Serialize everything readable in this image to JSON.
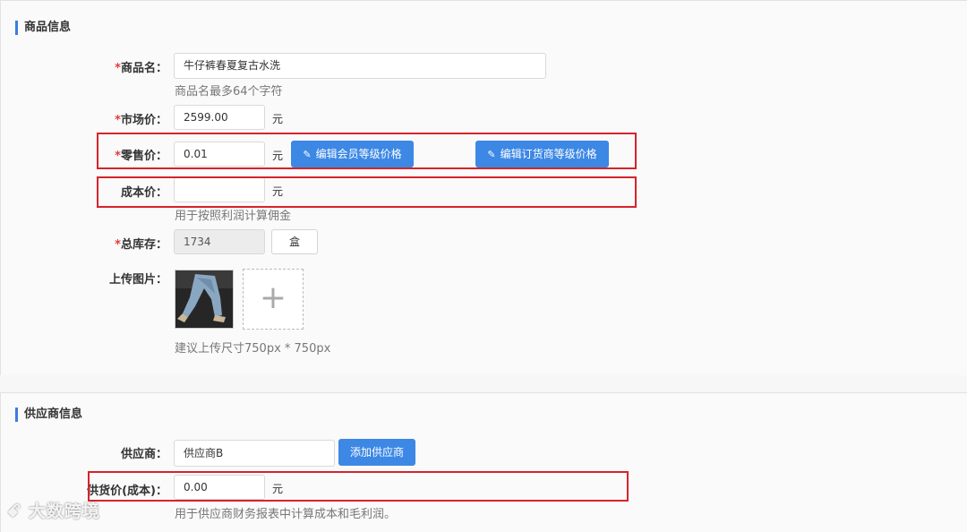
{
  "section_product": {
    "title": "商品信息",
    "name": {
      "label": "商品名：",
      "value": "牛仔裤春夏复古水洗",
      "hint": "商品名最多64个字符"
    },
    "market_price": {
      "label": "市场价：",
      "value": "2599.00",
      "unit": "元"
    },
    "retail_price": {
      "label": "零售价：",
      "value": "0.01",
      "unit": "元",
      "btn_member": "编辑会员等级价格",
      "btn_dealer": "编辑订货商等级价格"
    },
    "cost_price": {
      "label": "成本价：",
      "value": "",
      "unit": "元",
      "hint": "用于按照利润计算佣金"
    },
    "stock": {
      "label": "总库存：",
      "value": "1734",
      "unit_button": "盒"
    },
    "images": {
      "label": "上传图片：",
      "hint": "建议上传尺寸750px * 750px",
      "add_symbol": "+"
    }
  },
  "section_supplier": {
    "title": "供应商信息",
    "supplier": {
      "label": "供应商：",
      "value": "供应商B",
      "add_button": "添加供应商"
    },
    "supply_price": {
      "label": "供货价(成本)：",
      "value": "0.00",
      "unit": "元",
      "hint": "用于供应商财务报表中计算成本和毛利润。"
    }
  },
  "required_mark": "*",
  "watermark": {
    "text": "大数跨境",
    "logo": "ꗃ"
  },
  "colors": {
    "accent": "#3d88e5",
    "required": "#e4393c",
    "highlight": "#d6232c"
  },
  "icons": {
    "edit": "edit-icon",
    "plus": "plus-icon"
  }
}
